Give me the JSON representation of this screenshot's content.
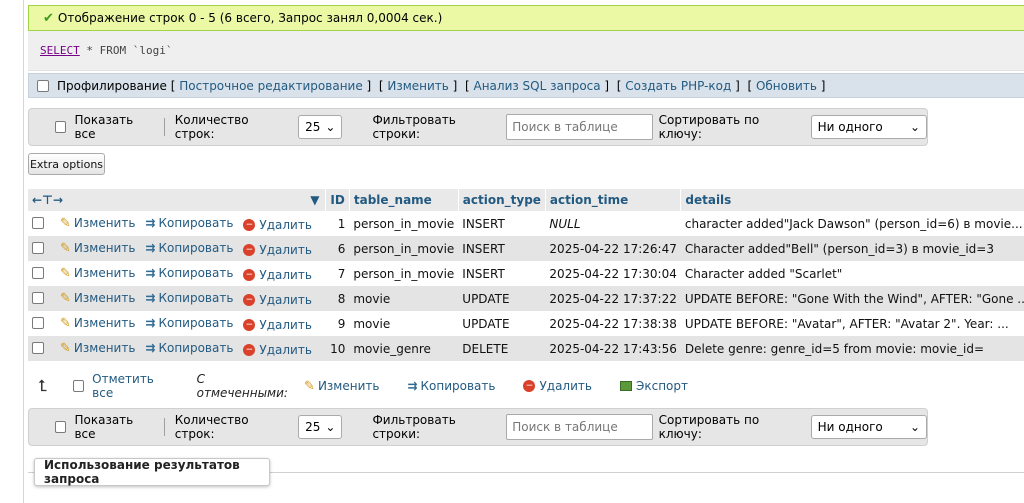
{
  "status": {
    "message": "Отображение строк 0 - 5 (6 всего, Запрос занял 0,0004 сек.)"
  },
  "sql": {
    "select_kw": "SELECT",
    "star": "*",
    "from_kw": "FROM",
    "table": "`logi`"
  },
  "profile_bar": {
    "profiling": "Профилирование",
    "links": [
      "Построчное редактирование",
      "Изменить",
      "Анализ SQL запроса",
      "Создать PHP-код",
      "Обновить"
    ]
  },
  "nav": {
    "show_all": "Показать все",
    "row_count_label": "Количество строк:",
    "row_count_value": "25",
    "filter_label": "Фильтровать строки:",
    "search_placeholder": "Поиск в таблице",
    "sort_label": "Сортировать по ключу:",
    "sort_value": "Ни одного"
  },
  "extra_options": "Extra options",
  "table": {
    "columns": [
      "ID",
      "table_name",
      "action_type",
      "action_time",
      "details"
    ],
    "action_labels": {
      "edit": "Изменить",
      "copy": "Копировать",
      "delete": "Удалить"
    },
    "rows": [
      {
        "id": "1",
        "table_name": "person_in_movie",
        "action_type": "INSERT",
        "action_time": "NULL",
        "details": "character added\"Jack Dawson\" (person_id=6) в movie..."
      },
      {
        "id": "6",
        "table_name": "person_in_movie",
        "action_type": "INSERT",
        "action_time": "2025-04-22 17:26:47",
        "details": "Character added\"Bell\" (person_id=3) в movie_id=3"
      },
      {
        "id": "7",
        "table_name": "person_in_movie",
        "action_type": "INSERT",
        "action_time": "2025-04-22 17:30:04",
        "details": "Character added \"Scarlet\""
      },
      {
        "id": "8",
        "table_name": "movie",
        "action_type": "UPDATE",
        "action_time": "2025-04-22 17:37:22",
        "details": "UPDATE BEFORE: \"Gone With the Wind\", AFTER: \"Gone ..."
      },
      {
        "id": "9",
        "table_name": "movie",
        "action_type": "UPDATE",
        "action_time": "2025-04-22 17:38:38",
        "details": "UPDATE BEFORE: \"Avatar\", AFTER: \"Avatar 2\". Year: ..."
      },
      {
        "id": "10",
        "table_name": "movie_genre",
        "action_type": "DELETE",
        "action_time": "2025-04-22 17:43:56",
        "details": "Delete genre: genre_id=5 from movie: movie_id="
      }
    ]
  },
  "bulk": {
    "check_all": "Отметить все",
    "with_selected": "С отмеченными:",
    "edit": "Изменить",
    "copy": "Копировать",
    "delete": "Удалить",
    "export": "Экспорт"
  },
  "results_box": "Использование результатов запроса"
}
